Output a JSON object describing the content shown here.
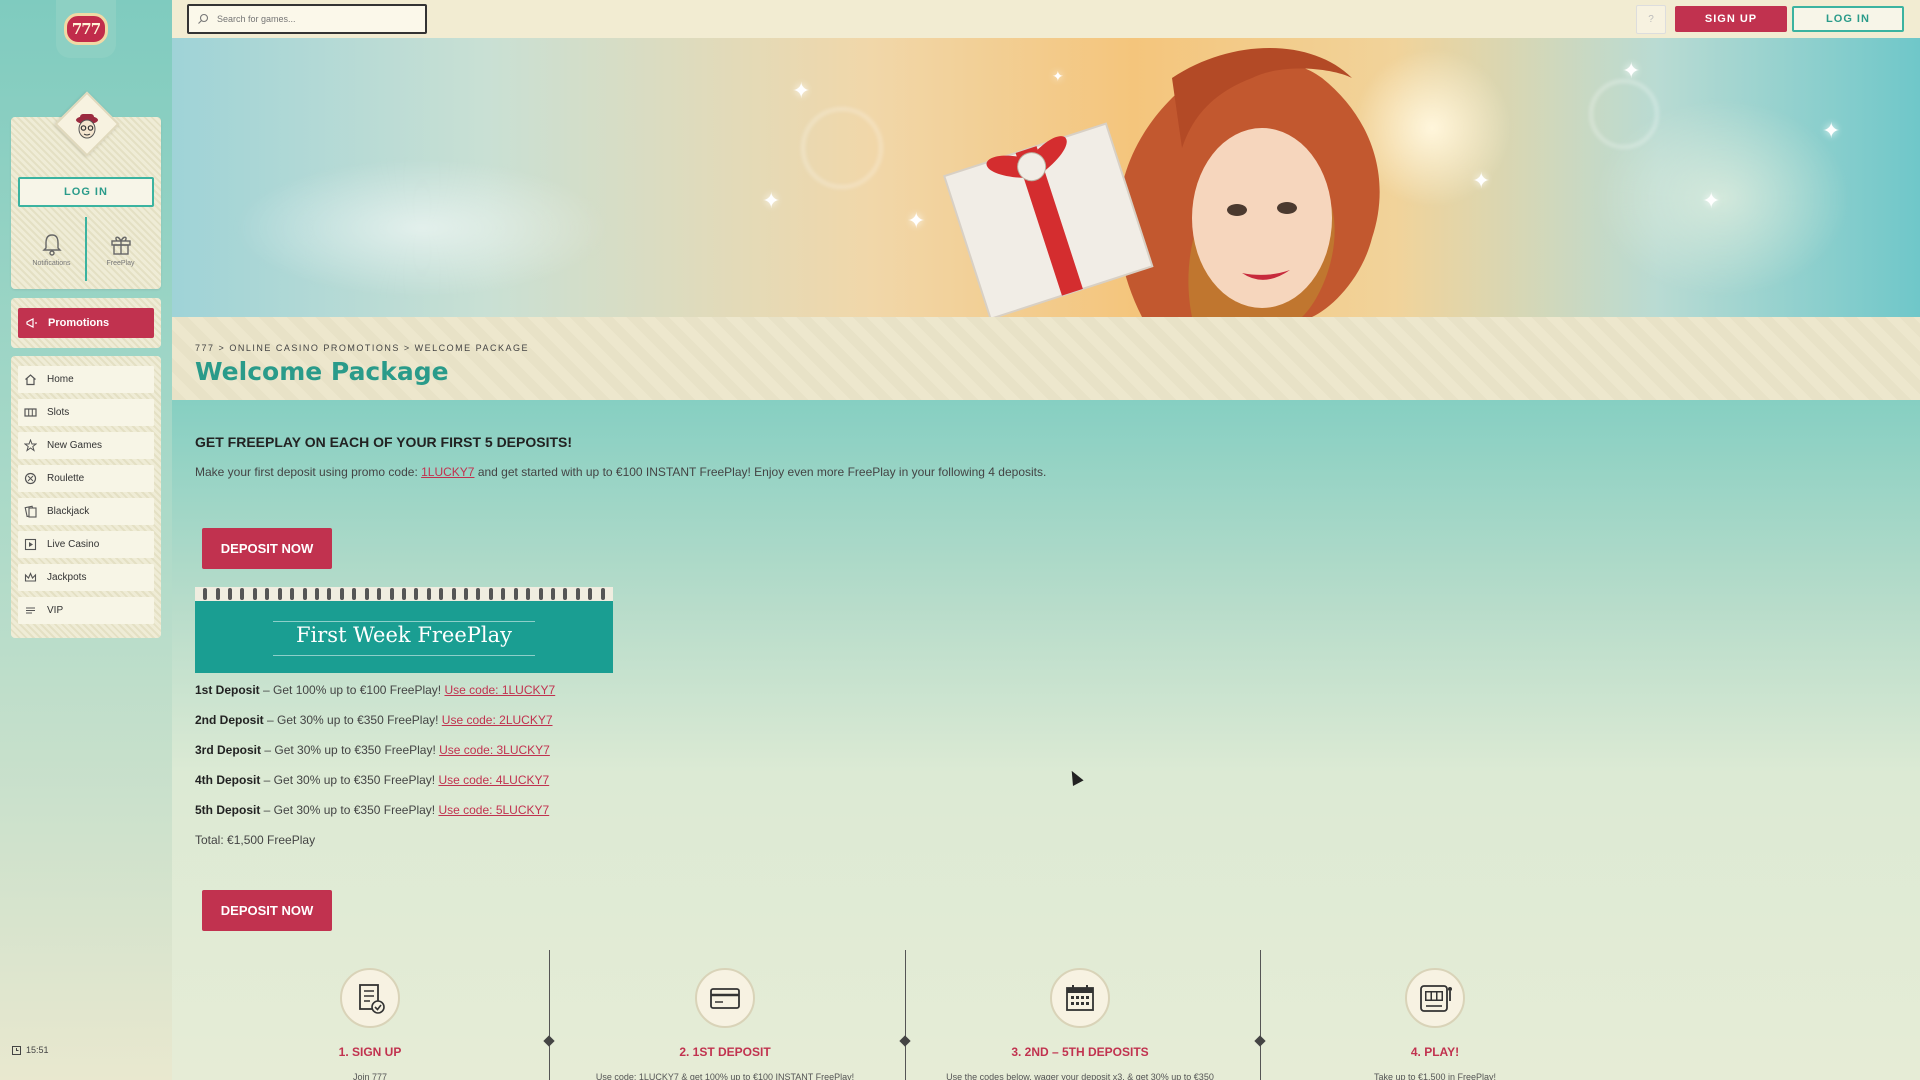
{
  "brand": {
    "logo_text": "777",
    "accent": "#c1324f",
    "teal": "#2a9b8a"
  },
  "sidebar": {
    "login_label": "LOG IN",
    "quick": [
      {
        "label": "Notifications",
        "icon": "bell-icon"
      },
      {
        "label": "FreePlay",
        "icon": "gift-icon"
      }
    ],
    "promotions_label": "Promotions",
    "nav": [
      {
        "label": "Home",
        "icon": "home-icon"
      },
      {
        "label": "Slots",
        "icon": "slots-icon"
      },
      {
        "label": "New Games",
        "icon": "star-icon"
      },
      {
        "label": "Roulette",
        "icon": "roulette-icon"
      },
      {
        "label": "Blackjack",
        "icon": "cards-icon"
      },
      {
        "label": "Live Casino",
        "icon": "play-icon"
      },
      {
        "label": "Jackpots",
        "icon": "crown-icon"
      },
      {
        "label": "VIP",
        "icon": "vip-icon"
      }
    ],
    "clock": "15:51"
  },
  "topbar": {
    "search_placeholder": "Search for games...",
    "help_label": "?",
    "signup_label": "SIGN UP",
    "login_label": "LOG IN"
  },
  "breadcrumb": [
    "777",
    ">",
    "ONLINE CASINO PROMOTIONS",
    ">",
    "WELCOME PACKAGE"
  ],
  "page_title": "Welcome Package",
  "main": {
    "headline": "GET FREEPLAY ON EACH OF YOUR FIRST 5 DEPOSITS!",
    "intro_before": "Make your first deposit using promo code: ",
    "intro_code": "1LUCKY7",
    "intro_after": " and get started with up to €100 INSTANT FreePlay! Enjoy even more FreePlay in your following 4 deposits.",
    "deposit_label": "DEPOSIT NOW",
    "card_title": "First Week FreePlay",
    "deposits": [
      {
        "name": "1st Deposit",
        "text": " – Get 100% up to €100 FreePlay! ",
        "code": "Use code: 1LUCKY7"
      },
      {
        "name": "2nd Deposit",
        "text": " – Get 30% up to €350 FreePlay! ",
        "code": "Use code: 2LUCKY7"
      },
      {
        "name": "3rd Deposit",
        "text": " – Get 30% up to €350 FreePlay! ",
        "code": "Use code: 3LUCKY7"
      },
      {
        "name": "4th Deposit",
        "text": " – Get 30% up to €350 FreePlay! ",
        "code": "Use code: 4LUCKY7"
      },
      {
        "name": "5th Deposit",
        "text": " – Get 30% up to €350 FreePlay! ",
        "code": "Use code: 5LUCKY7"
      }
    ],
    "total": "Total: €1,500 FreePlay",
    "steps": [
      {
        "title": "1. SIGN UP",
        "desc": "Join 777",
        "icon": "signup-icon"
      },
      {
        "title": "2. 1ST DEPOSIT",
        "desc": "Use code: 1LUCKY7 & get 100% up to €100 INSTANT FreePlay!",
        "icon": "card-icon"
      },
      {
        "title": "3. 2ND – 5TH DEPOSITS",
        "desc": "Use the codes below, wager your deposit x3, & get 30% up to €350",
        "icon": "calendar-icon"
      },
      {
        "title": "4. PLAY!",
        "desc": "Take up to €1,500 in FreePlay!",
        "icon": "slot-machine-icon"
      }
    ]
  }
}
